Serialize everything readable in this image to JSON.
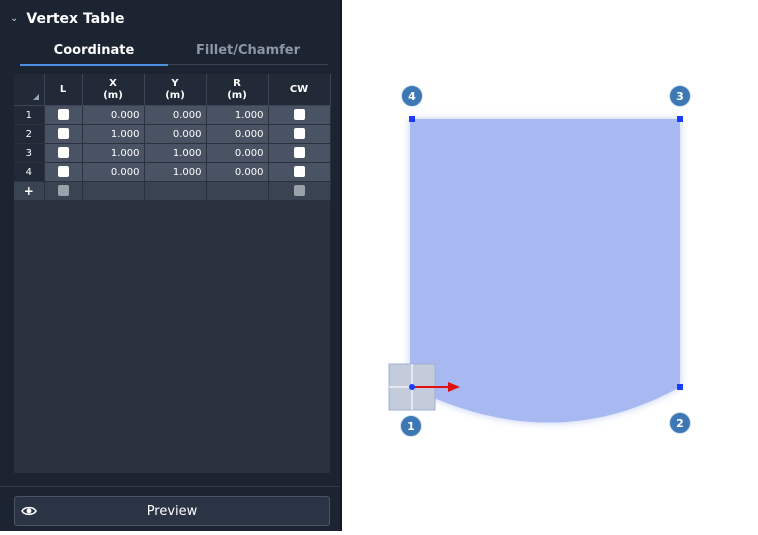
{
  "panel": {
    "title": "Vertex Table",
    "tabs": [
      "Coordinate",
      "Fillet/Chamfer"
    ]
  },
  "table": {
    "columns": [
      {
        "line1": "L",
        "line2": ""
      },
      {
        "line1": "X",
        "line2": "(m)"
      },
      {
        "line1": "Y",
        "line2": "(m)"
      },
      {
        "line1": "R",
        "line2": "(m)"
      },
      {
        "line1": "CW",
        "line2": ""
      }
    ],
    "rows": [
      {
        "num": "1",
        "x": "0.000",
        "y": "0.000",
        "r": "1.000"
      },
      {
        "num": "2",
        "x": "1.000",
        "y": "0.000",
        "r": "0.000"
      },
      {
        "num": "3",
        "x": "1.000",
        "y": "1.000",
        "r": "0.000"
      },
      {
        "num": "4",
        "x": "0.000",
        "y": "1.000",
        "r": "0.000"
      }
    ],
    "add_symbol": "+"
  },
  "preview": {
    "label": "Preview"
  },
  "viewport": {
    "vertex_labels": [
      "1",
      "2",
      "3",
      "4"
    ],
    "fill_color": "#a8b9f2",
    "handle_color": "#1a3cff",
    "arrow_color": "#e01010"
  }
}
